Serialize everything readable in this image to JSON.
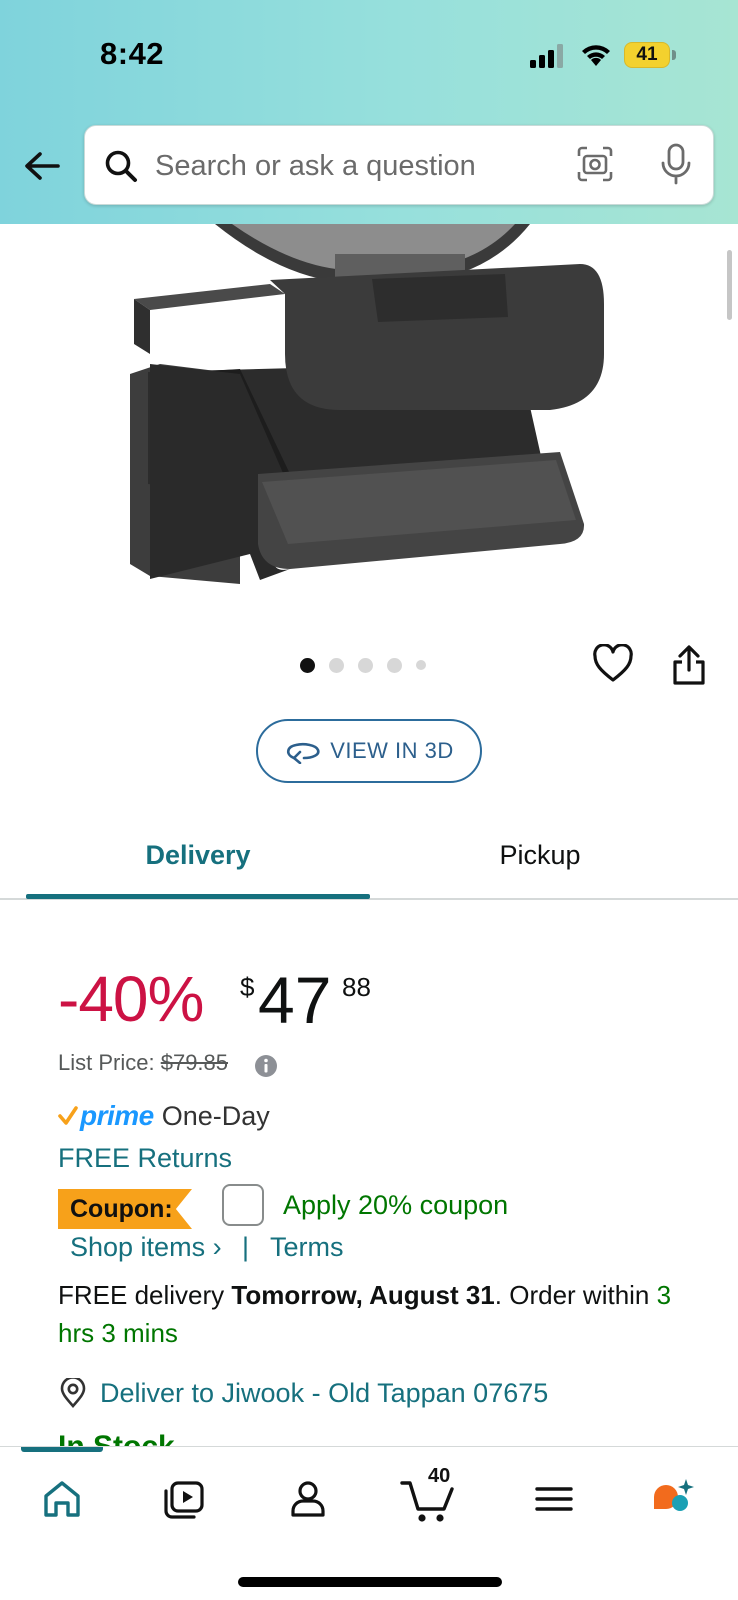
{
  "status_bar": {
    "time": "8:42",
    "battery": "41"
  },
  "search": {
    "placeholder": "Search or ask a question"
  },
  "gallery": {
    "dot_count": 5,
    "active_index": 0
  },
  "view_3d": {
    "label": "VIEW IN 3D"
  },
  "tabs": [
    {
      "label": "Delivery",
      "active": true
    },
    {
      "label": "Pickup",
      "active": false
    }
  ],
  "price": {
    "discount": "-40%",
    "currency": "$",
    "whole": "47",
    "fraction": "88",
    "list_price_label": "List Price:",
    "list_price": "$79.85"
  },
  "prime": {
    "brand": "prime",
    "speed": "One-Day"
  },
  "free_returns": "FREE Returns",
  "coupon": {
    "badge": "Coupon:",
    "label": "Apply 20% coupon",
    "shop_items": "Shop items ›",
    "separator": "|",
    "terms": "Terms"
  },
  "delivery": {
    "prefix": "FREE delivery ",
    "date": "Tomorrow, August 31",
    "mid": ". Order within ",
    "countdown": "3 hrs 3 mins"
  },
  "location": {
    "label": "Deliver to Jiwook - Old Tappan 07675"
  },
  "stock": {
    "label": "In Stock"
  },
  "bottom_nav": {
    "cart_count": "40"
  },
  "colors": {
    "teal": "#16707e",
    "discount_red": "#cc1244",
    "green": "#007600",
    "prime_blue": "#1a98ff",
    "coupon_orange": "#f7a11a"
  }
}
